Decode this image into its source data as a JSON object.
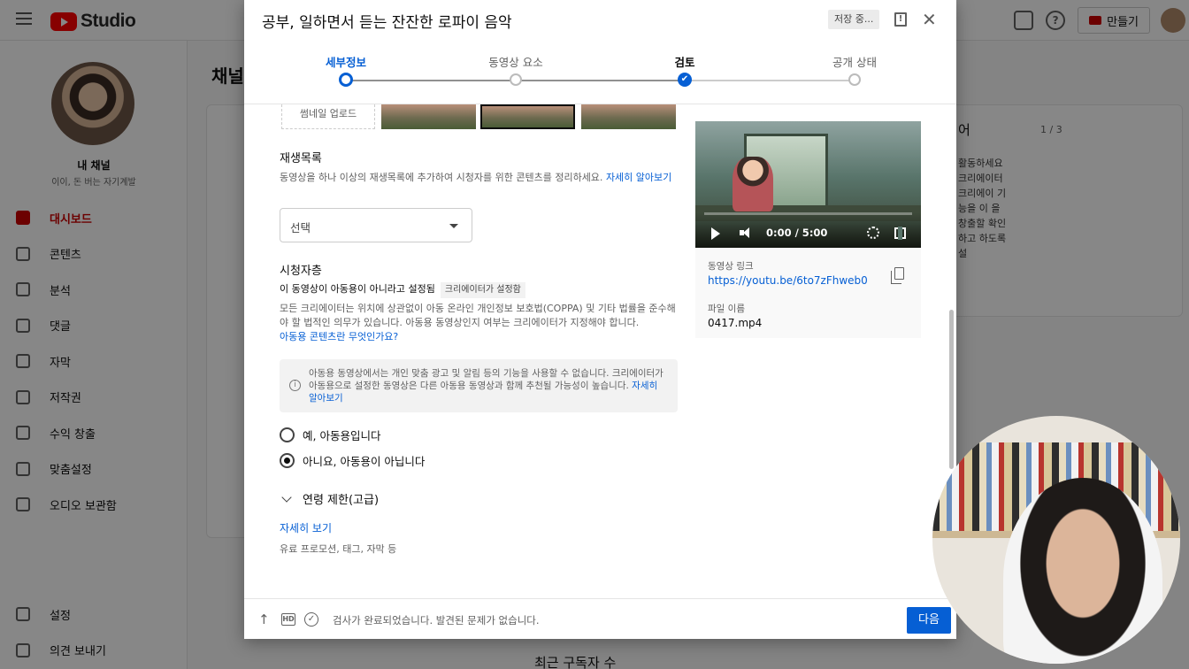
{
  "studio": {
    "logo_text": "Studio",
    "create_label": "만들기",
    "channel_name": "내 채널",
    "channel_sub": "이이, 돈 버는 자기계발",
    "nav": [
      {
        "label": "대시보드",
        "icon": "dashboard-icon"
      },
      {
        "label": "콘텐츠",
        "icon": "content-icon"
      },
      {
        "label": "분석",
        "icon": "analytics-icon"
      },
      {
        "label": "댓글",
        "icon": "comments-icon"
      },
      {
        "label": "자막",
        "icon": "subtitles-icon"
      },
      {
        "label": "저작권",
        "icon": "copyright-icon"
      },
      {
        "label": "수익 창출",
        "icon": "monetization-icon"
      },
      {
        "label": "맞춤설정",
        "icon": "customization-icon"
      },
      {
        "label": "오디오 보관함",
        "icon": "audio-library-icon"
      }
    ],
    "nav_bottom": [
      {
        "label": "설정",
        "icon": "settings-icon"
      },
      {
        "label": "의견 보내기",
        "icon": "feedback-icon"
      }
    ],
    "main_title": "채널",
    "right_card_title": "어",
    "right_card_pager": "1 / 3",
    "right_card_text": "활동하세요 크리에이터 크리에이 기능을 이 을 창출할 확인하고 하도록 설",
    "recent_subs": "최근 구독자 수"
  },
  "dialog": {
    "title": "공부, 일하면서 듣는 잔잔한 로파이 음악",
    "save_status": "저장 중...",
    "steps": [
      {
        "label": "세부정보"
      },
      {
        "label": "동영상 요소"
      },
      {
        "label": "검토"
      },
      {
        "label": "공개 상태"
      }
    ],
    "thumbnail_upload": "썸네일 업로드",
    "playlist": {
      "title": "재생목록",
      "desc": "동영상을 하나 이상의 재생목록에 추가하여 시청자를 위한 콘텐츠를 정리하세요.",
      "link": "자세히 알아보기",
      "select_value": "선택"
    },
    "audience": {
      "title": "시청자층",
      "status_text": "이 동영상이 아동용이 아니라고 설정됨",
      "status_chip": "크리에이터가 설정함",
      "desc": "모든 크리에이터는 위치에 상관없이 아동 온라인 개인정보 보호법(COPPA) 및 기타 법률을 준수해야 할 법적인 의무가 있습니다. 아동용 동영상인지 여부는 크리에이터가 지정해야 합니다.",
      "desc_link": "아동용 콘텐츠란 무엇인가요?",
      "info_text": "아동용 동영상에서는 개인 맞춤 광고 및 알림 등의 기능을 사용할 수 없습니다. 크리에이터가 아동용으로 설정한 동영상은 다른 아동용 동영상과 함께 추천될 가능성이 높습니다.",
      "info_link": "자세히 알아보기",
      "option_yes": "예, 아동용입니다",
      "option_no": "아니요, 아동용이 아닙니다",
      "selected": "no"
    },
    "age_restriction": "연령 제한(고급)",
    "show_more": "자세히 보기",
    "show_more_desc": "유료 프로모션, 태그, 자막 등",
    "preview": {
      "time": "0:00 / 5:00",
      "link_label": "동영상 링크",
      "link_value": "https://youtu.be/6to7zFhweb0",
      "file_label": "파일 이름",
      "file_value": "0417.mp4"
    },
    "footer": {
      "hd": "HD",
      "status": "검사가 완료되었습니다. 발견된 문제가 없습니다.",
      "next_label": "다음"
    }
  },
  "colors": {
    "accent": "#065fd4",
    "brand": "#ff0000"
  }
}
